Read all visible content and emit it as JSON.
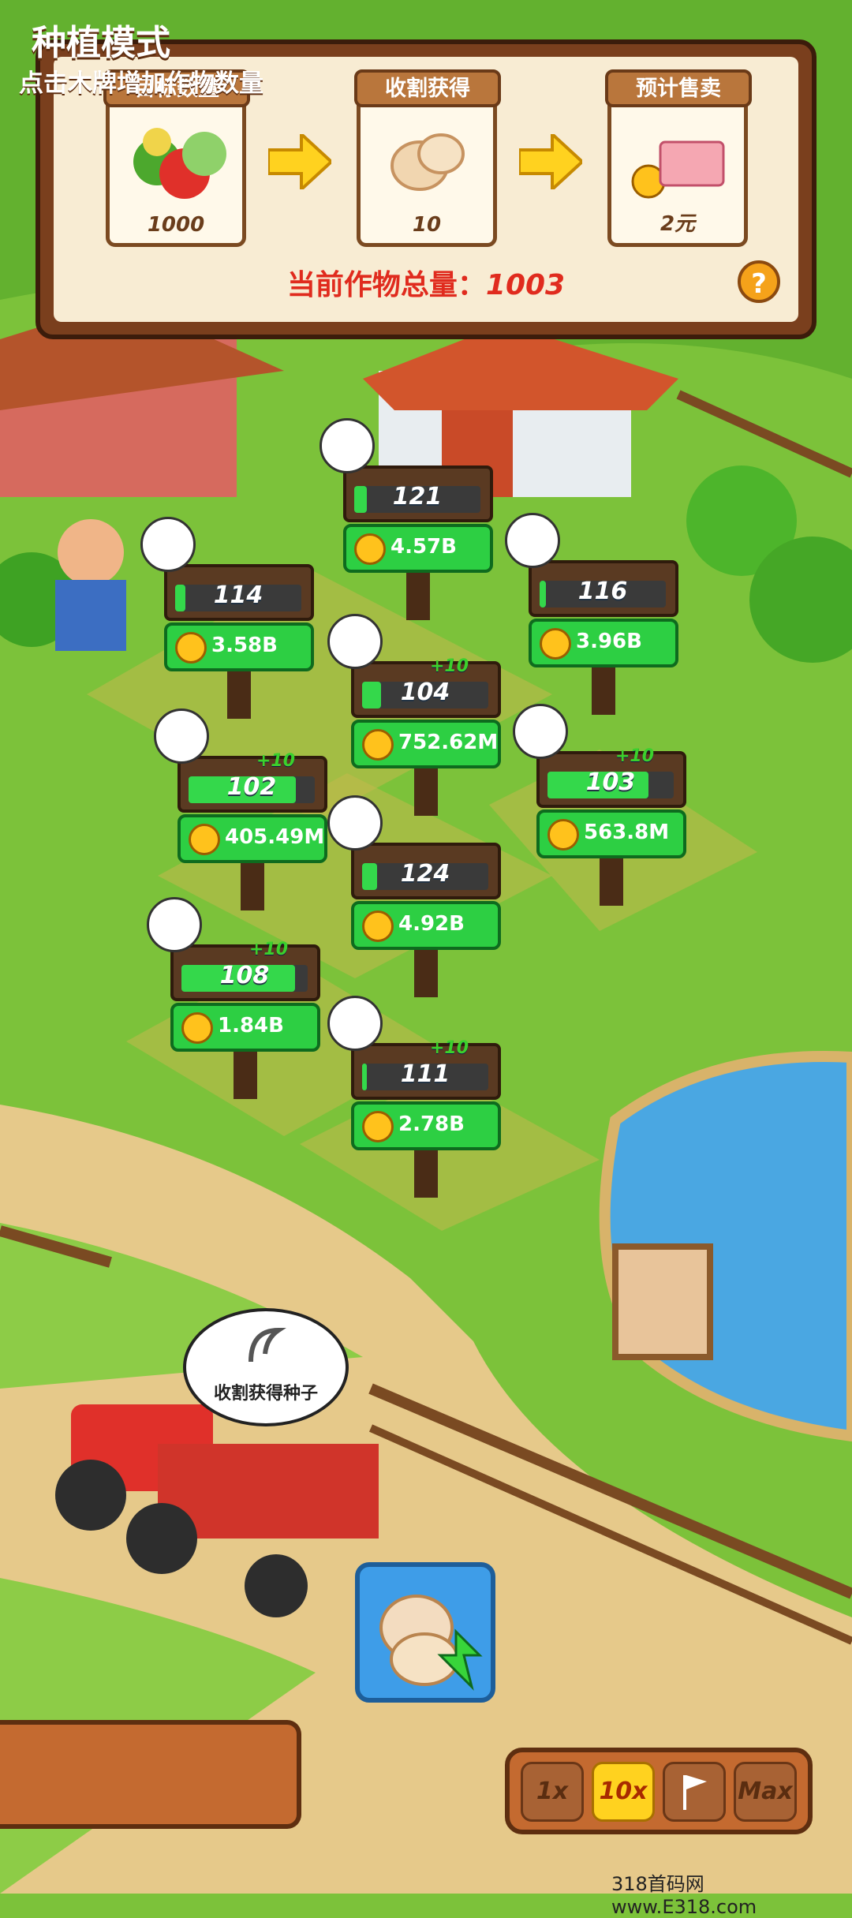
{
  "top_panel": {
    "target": {
      "title": "目标数量",
      "value": "1000",
      "icon": "vegetables-icon"
    },
    "harvest": {
      "title": "收割获得",
      "value": "10",
      "icon": "seeds-icon"
    },
    "sell": {
      "title": "预计售卖",
      "value": "2元",
      "icon": "money-icon"
    },
    "total_label": "当前作物总量：",
    "total_value": "1003",
    "help_label": "?"
  },
  "signs": [
    {
      "id": "giraffe",
      "animal": "giraffe-icon",
      "count": "121",
      "money": "4.57B",
      "plus": "",
      "fill": 0.1
    },
    {
      "id": "rabbit",
      "animal": "rabbit-icon",
      "count": "114",
      "money": "3.58B",
      "plus": "",
      "fill": 0.08
    },
    {
      "id": "strawberry",
      "animal": "strawberry-icon",
      "count": "116",
      "money": "3.96B",
      "plus": "",
      "fill": 0.05
    },
    {
      "id": "onion",
      "animal": "onion-icon",
      "count": "104",
      "money": "752.62M",
      "plus": "+10",
      "fill": 0.15
    },
    {
      "id": "banana",
      "animal": "banana-icon",
      "count": "102",
      "money": "405.49M",
      "plus": "+10",
      "fill": 0.85
    },
    {
      "id": "swan",
      "animal": "swan-icon",
      "count": "103",
      "money": "563.8M",
      "plus": "+10",
      "fill": 0.8
    },
    {
      "id": "sunflower",
      "animal": "sunflower-icon",
      "count": "124",
      "money": "4.92B",
      "plus": "",
      "fill": 0.12
    },
    {
      "id": "pig",
      "animal": "pig-icon",
      "count": "108",
      "money": "1.84B",
      "plus": "+10",
      "fill": 0.9
    },
    {
      "id": "watermelon",
      "animal": "watermelon-icon",
      "count": "111",
      "money": "2.78B",
      "plus": "+10",
      "fill": 0.04
    }
  ],
  "bubble": {
    "text": "收割获得种子",
    "icon": "sickle-icon"
  },
  "mode": {
    "title": "种植模式",
    "subtitle": "点击木牌增加作物数量"
  },
  "speed": {
    "options": [
      "1x",
      "10x",
      "",
      "Max"
    ],
    "selected": "10x",
    "flag_icon": "flag-icon"
  },
  "watermark": "318首码网 www.E318.com",
  "colors": {
    "grass": "#7cc23a",
    "sign_green": "#2dcf43",
    "highlight": "#ffd21f",
    "red_text": "#e02b1e"
  }
}
